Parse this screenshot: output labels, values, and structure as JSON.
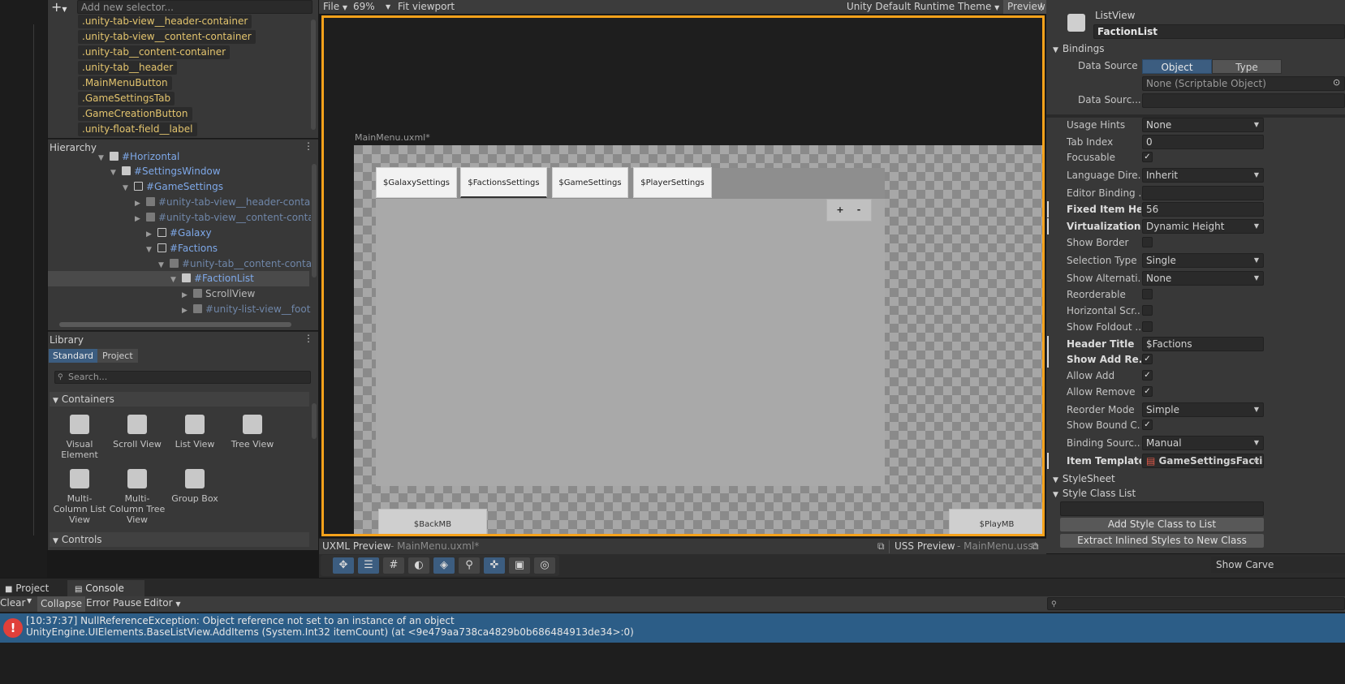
{
  "selectors": {
    "placeholder": "Add new selector...",
    "items": [
      ".unity-tab-view__header-container",
      ".unity-tab-view__content-container",
      ".unity-tab__content-container",
      ".unity-tab__header",
      ".MainMenuButton",
      ".GameSettingsTab",
      ".GameCreationButton",
      ".unity-float-field__label"
    ]
  },
  "hierarchy": {
    "title": "Hierarchy",
    "rows": [
      {
        "label": "#Horizontal"
      },
      {
        "label": "#SettingsWindow"
      },
      {
        "label": "#GameSettings"
      },
      {
        "label": "#unity-tab-view__header-container"
      },
      {
        "label": "#unity-tab-view__content-container"
      },
      {
        "label": "#Galaxy"
      },
      {
        "label": "#Factions"
      },
      {
        "label": "#unity-tab__content-container"
      },
      {
        "label": "#FactionList"
      },
      {
        "label": "ScrollView"
      },
      {
        "label": "#unity-list-view__footer"
      }
    ]
  },
  "library": {
    "title": "Library",
    "tabs": [
      "Standard",
      "Project"
    ],
    "search_placeholder": "Search...",
    "containers_label": "Containers",
    "controls_label": "Controls",
    "items": [
      "Visual Element",
      "Scroll View",
      "List View",
      "Tree View",
      "Multi-Column List View",
      "Multi-Column Tree View",
      "Group Box"
    ]
  },
  "toolbar": {
    "file": "File",
    "zoom": "69%",
    "fit": "Fit viewport",
    "theme": "Unity Default Runtime Theme",
    "preview": "Preview"
  },
  "canvas": {
    "doc_title": "MainMenu.uxml*",
    "tabs": [
      "$GalaxySettings",
      "$FactionsSettings",
      "$GameSettings",
      "$PlayerSettings"
    ],
    "plus": "+",
    "minus": "-",
    "back": "$BackMB",
    "play": "$PlayMB"
  },
  "previews": {
    "uxml_label": "UXML Preview",
    "uxml_file": "- MainMenu.uxml*",
    "uss_label": "USS Preview",
    "uss_file": "- MainMenu.uss*"
  },
  "inspector": {
    "type": "ListView",
    "name": "FactionList",
    "bindings_label": "Bindings",
    "data_source_label": "Data Source",
    "object_btn": "Object",
    "type_btn": "Type",
    "none_so": "None (Scriptable Object)",
    "data_source_path_label": "Data Sourc...",
    "props": [
      {
        "label": "Usage Hints",
        "value": "None"
      },
      {
        "label": "Tab Index",
        "value": "0"
      },
      {
        "label": "Focusable",
        "value": "✓"
      },
      {
        "label": "Language Dire...",
        "value": "Inherit"
      },
      {
        "label": "Editor Binding ...",
        "value": ""
      },
      {
        "label": "Fixed Item Hei...",
        "value": "56"
      },
      {
        "label": "Virtualization ...",
        "value": "Dynamic Height"
      },
      {
        "label": "Show Border",
        "value": ""
      },
      {
        "label": "Selection Type",
        "value": "Single"
      },
      {
        "label": "Show Alternati...",
        "value": "None"
      },
      {
        "label": "Reorderable",
        "value": ""
      },
      {
        "label": "Horizontal Scr...",
        "value": ""
      },
      {
        "label": "Show Foldout ...",
        "value": ""
      },
      {
        "label": "Header Title",
        "value": "$Factions"
      },
      {
        "label": "Show Add Re...",
        "value": "✓"
      },
      {
        "label": "Allow Add",
        "value": "✓"
      },
      {
        "label": "Allow Remove",
        "value": "✓"
      },
      {
        "label": "Reorder Mode",
        "value": "Simple"
      },
      {
        "label": "Show Bound C...",
        "value": "✓"
      },
      {
        "label": "Binding Sourc...",
        "value": "Manual"
      },
      {
        "label": "Item Template",
        "value": "GameSettingsFactior"
      }
    ],
    "stylesheet_label": "StyleSheet",
    "style_class_list_label": "Style Class List",
    "add_class_btn": "Add Style Class to List",
    "extract_btn": "Extract Inlined Styles to New Class"
  },
  "scene": {
    "show_carve": "Show Carve"
  },
  "console": {
    "tabs": [
      "Project",
      "Console"
    ],
    "clear": "Clear",
    "collapse": "Collapse",
    "error_pause": "Error Pause",
    "editor": "Editor",
    "line1": "[10:37:37] NullReferenceException: Object reference not set to an instance of an object",
    "line2": "UnityEngine.UIElements.BaseListView.AddItems (System.Int32 itemCount) (at <9e479aa738ca4829b0b686484913de34>:0)"
  },
  "colors": {
    "accent": "#f7a21b",
    "selection": "#2c5d87",
    "tag_text": "#e3c46e",
    "link": "#7ea8e8"
  }
}
